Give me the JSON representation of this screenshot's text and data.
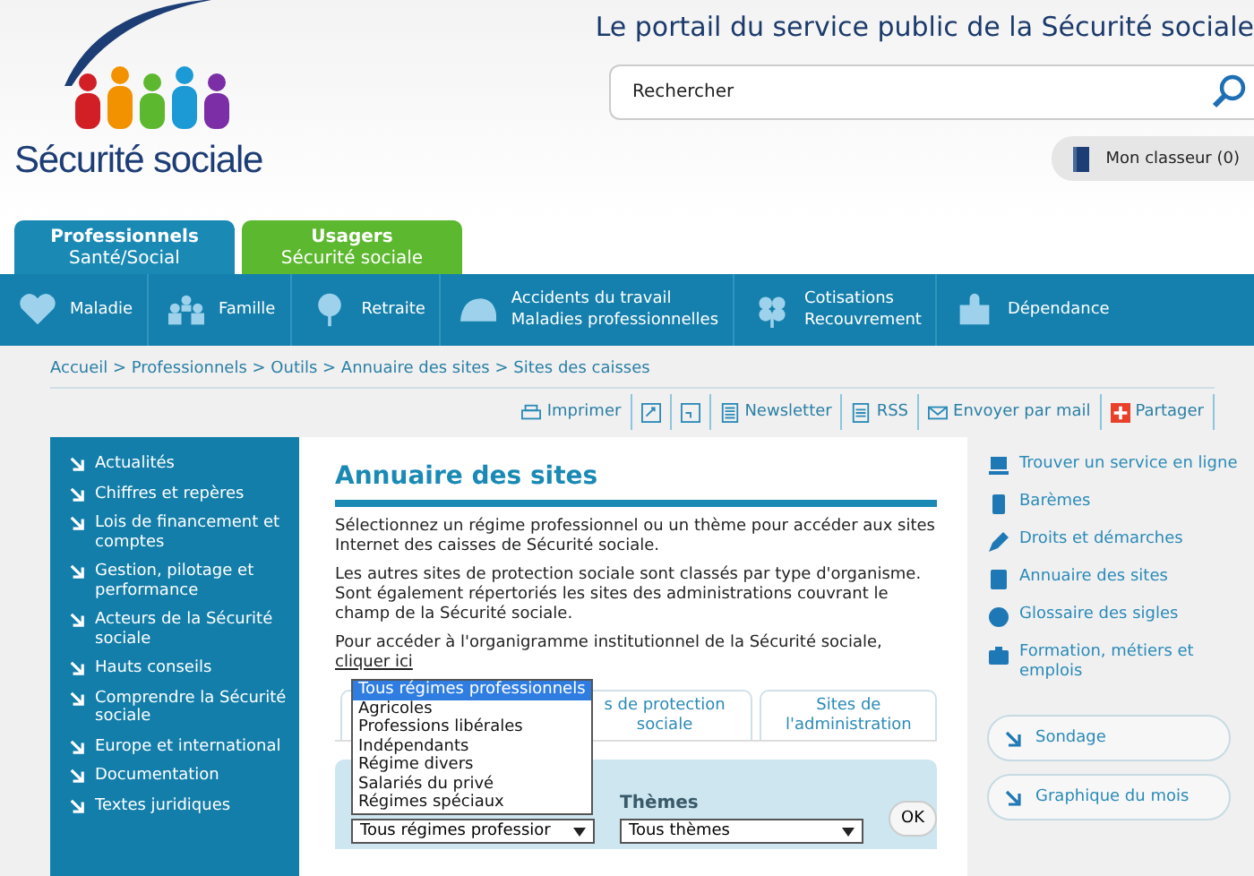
{
  "header": {
    "logo_text": "Sécurité sociale",
    "tagline": "Le portail du service public de la Sécurité sociale",
    "search": {
      "placeholder": "Rechercher"
    },
    "binder": "Mon classeur (0)"
  },
  "audience_tabs": [
    {
      "line1": "Professionnels",
      "line2": "Santé/Social",
      "selected": true
    },
    {
      "line1": "Usagers",
      "line2": "Sécurité sociale",
      "selected": false
    }
  ],
  "nav": [
    {
      "lines": [
        "Maladie"
      ]
    },
    {
      "lines": [
        "Famille"
      ]
    },
    {
      "lines": [
        "Retraite"
      ]
    },
    {
      "lines": [
        "Accidents  du travail",
        "Maladies professionnelles"
      ]
    },
    {
      "lines": [
        "Cotisations",
        "Recouvrement"
      ]
    },
    {
      "lines": [
        "Dépendance"
      ]
    }
  ],
  "breadcrumb": "Accueil > Professionnels > Outils > Annuaire des sites > Sites des caisses",
  "tools": [
    {
      "kind": "link",
      "label": "Imprimer"
    },
    {
      "kind": "button"
    },
    {
      "kind": "button"
    },
    {
      "kind": "link",
      "label": "Newsletter"
    },
    {
      "kind": "link",
      "label": "RSS"
    },
    {
      "kind": "link",
      "label": "Envoyer par mail"
    },
    {
      "kind": "link",
      "label": "Partager"
    }
  ],
  "sidebar": [
    "Actualités",
    "Chiffres et repères",
    "Lois de financement et comptes",
    "Gestion, pilotage et performance",
    "Acteurs de la Sécurité sociale",
    "Hauts conseils",
    "Comprendre la Sécurité sociale",
    "Europe et international",
    "Documentation",
    "Textes juridiques"
  ],
  "main": {
    "title": "Annuaire des sites",
    "paragraphs": [
      "Sélectionnez un régime professionnel ou un thème pour accéder aux sites Internet des caisses de Sécurité sociale.",
      "Les autres sites de protection sociale sont classés par type d'organisme. Sont également répertoriés les sites des administrations couvrant le champ de la Sécurité sociale."
    ],
    "link_paragraph": {
      "text": "Pour accéder à l'organigramme institutionnel de la Sécurité sociale, ",
      "link": "cliquer ici"
    },
    "tabs": [
      {
        "lines": [
          "s de protection",
          "sociale"
        ]
      },
      {
        "lines": [
          "Sites de",
          "l'administration"
        ]
      }
    ],
    "filter": {
      "regime_value": "Tous régimes professior",
      "themes_label": "Thèmes",
      "themes_value": "Tous thèmes",
      "button": "OK"
    },
    "dropdown": [
      {
        "label": "Tous régimes professionnels",
        "selected": true
      },
      {
        "label": "Agricoles",
        "selected": false
      },
      {
        "label": "Professions libérales",
        "selected": false
      },
      {
        "label": "Indépendants",
        "selected": false
      },
      {
        "label": "Régime divers",
        "selected": false
      },
      {
        "label": "Salariés du privé",
        "selected": false
      },
      {
        "label": "Régimes spéciaux",
        "selected": false
      }
    ]
  },
  "right_links": [
    "Trouver un service en ligne",
    "Barèmes",
    "Droits et démarches",
    "Annuaire des sites",
    "Glossaire des sigles",
    "Formation, métiers et emplois"
  ],
  "right_buttons": [
    "Sondage",
    "Graphique du mois"
  ]
}
